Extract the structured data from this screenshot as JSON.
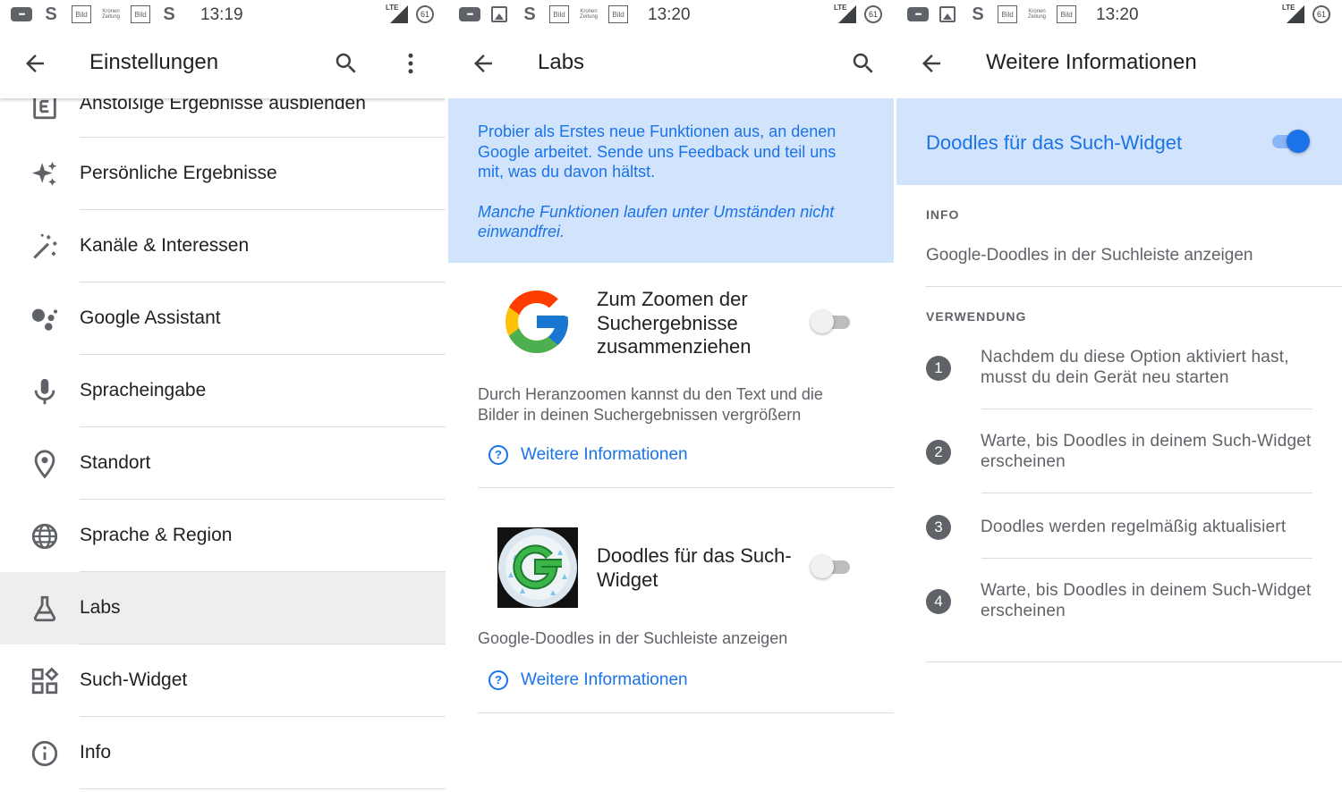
{
  "panels": {
    "settings": {
      "time": "13:19",
      "title": "Einstellungen",
      "items": [
        {
          "label": "Anstößige Ergebnisse ausblenden",
          "icon": "explicit-icon"
        },
        {
          "label": "Persönliche Ergebnisse",
          "icon": "sparkle-icon"
        },
        {
          "label": "Kanäle & Interessen",
          "icon": "magic-wand-icon"
        },
        {
          "label": "Google Assistant",
          "icon": "assistant-icon"
        },
        {
          "label": "Spracheingabe",
          "icon": "microphone-icon"
        },
        {
          "label": "Standort",
          "icon": "location-pin-icon"
        },
        {
          "label": "Sprache & Region",
          "icon": "globe-icon"
        },
        {
          "label": "Labs",
          "icon": "flask-icon"
        },
        {
          "label": "Such-Widget",
          "icon": "widgets-icon"
        },
        {
          "label": "Info",
          "icon": "info-icon"
        }
      ]
    },
    "labs": {
      "time": "13:20",
      "title": "Labs",
      "banner_text": "Probier als Erstes neue Funktionen aus, an denen Google arbeitet. Sende uns Feedback und teil uns mit, was du davon hältst.",
      "banner_warning": "Manche Funktionen laufen unter Umständen nicht einwandfrei.",
      "features": [
        {
          "title": "Zum Zoomen der Suchergebnisse zusammenziehen",
          "description": "Durch Heranzoomen kannst du den Text und die Bilder in deinen Suchergebnissen vergrößern",
          "link": "Weitere Informationen",
          "enabled": false
        },
        {
          "title": "Doodles für das Such-Widget",
          "description": "Google-Doodles in der Suchleiste anzeigen",
          "link": "Weitere Informationen",
          "enabled": false
        }
      ]
    },
    "more_info": {
      "time": "13:20",
      "title": "Weitere Informationen",
      "feature_label": "Doodles für das Such-Widget",
      "enabled": true,
      "info_header": "INFO",
      "info_text": "Google-Doodles in der Suchleiste anzeigen",
      "usage_header": "VERWENDUNG",
      "steps": [
        {
          "num": "1",
          "text": "Nachdem du diese Option aktiviert hast, musst du dein Gerät neu starten"
        },
        {
          "num": "2",
          "text": "Warte, bis Doodles in deinem Such-Widget erscheinen"
        },
        {
          "num": "3",
          "text": "Doodles werden regelmäßig aktualisiert"
        },
        {
          "num": "4",
          "text": "Warte, bis Doodles in deinem Such-Widget erscheinen"
        }
      ]
    }
  },
  "statusbar": {
    "network": "LTE",
    "battery": "61",
    "bild_text": "Bild",
    "kz_text": "Kronen Zeitung",
    "s_text": "S"
  },
  "colors": {
    "accent": "#1a73e8",
    "banner": "#d2e3fc",
    "active_row": "#eeeeee"
  }
}
